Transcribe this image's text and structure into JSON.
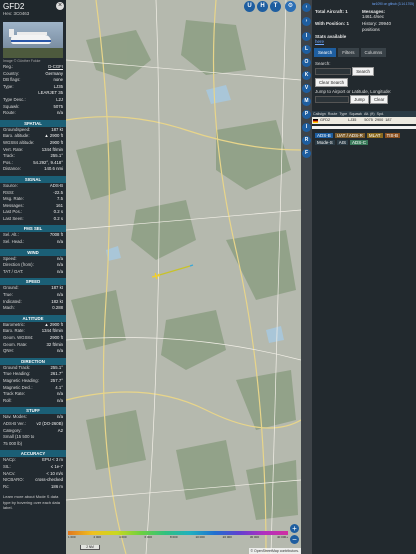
{
  "left_panel": {
    "callsign": "GFD2",
    "hex_line": "Hex: 3C0463",
    "photo_credit": "Image © Günther Fokke",
    "basic": [
      {
        "label": "Reg.:",
        "value": "D-CGFI",
        "link": true
      },
      {
        "label": "Country:",
        "value": "Germany"
      },
      {
        "label": "DB flags:",
        "value": "none"
      },
      {
        "label": "Type:",
        "value": "LJ35"
      },
      {
        "label": "",
        "value": "LEARJET 35"
      },
      {
        "label": "Type Desc.:",
        "value": "L2J"
      },
      {
        "label": "Squawk:",
        "value": "5075"
      },
      {
        "label": "Route:",
        "value": "n/a"
      }
    ],
    "sections": [
      {
        "title": "SPATIAL",
        "rows": [
          {
            "label": "Groundspeed:",
            "value": "187 kt"
          },
          {
            "label": "Baro. altitude:",
            "value": "▲ 2900 ft"
          },
          {
            "label": "WGS84 altitude:",
            "value": "2900 ft"
          },
          {
            "label": "Vert. Rate:",
            "value": "1344 ft/min"
          },
          {
            "label": "Track:",
            "value": "255.1°"
          },
          {
            "label": "Pos.:",
            "value": "54.292°, 9.418°"
          },
          {
            "label": "Distance:",
            "value": "140.6 nmi"
          }
        ]
      },
      {
        "title": "SIGNAL",
        "rows": [
          {
            "label": "Source:",
            "value": "ADS-B"
          },
          {
            "label": "RSSI:",
            "value": "-22.5"
          },
          {
            "label": "Msg. Rate:",
            "value": "7.5"
          },
          {
            "label": "Messages:",
            "value": "161"
          },
          {
            "label": "Last Pos.:",
            "value": "0.2 s"
          },
          {
            "label": "Last Seen:",
            "value": "0.2 s"
          }
        ]
      },
      {
        "title": "FMS SEL",
        "rows": [
          {
            "label": "Sel. Alt.:",
            "value": "7008 ft"
          },
          {
            "label": "Sel. Head.:",
            "value": "n/a"
          }
        ]
      },
      {
        "title": "WIND",
        "rows": [
          {
            "label": "Speed:",
            "value": "n/a"
          },
          {
            "label": "Direction (from):",
            "value": "n/a"
          },
          {
            "label": "TAT / OAT:",
            "value": "n/a"
          }
        ]
      },
      {
        "title": "SPEED",
        "rows": [
          {
            "label": "Ground:",
            "value": "187 kt"
          },
          {
            "label": "True:",
            "value": "n/a"
          },
          {
            "label": "Indicated:",
            "value": "182 kt"
          },
          {
            "label": "Mach:",
            "value": "0.288"
          }
        ]
      },
      {
        "title": "ALTITUDE",
        "rows": [
          {
            "label": "Barometric:",
            "value": "▲ 2900 ft"
          },
          {
            "label": "Baro. Rate:",
            "value": "1344 ft/min"
          },
          {
            "label": "Geom. WGS84:",
            "value": "2900 ft"
          },
          {
            "label": "Geom. Rate:",
            "value": "32 ft/min"
          },
          {
            "label": "QNH:",
            "value": "n/a"
          }
        ]
      },
      {
        "title": "DIRECTION",
        "rows": [
          {
            "label": "Ground Track:",
            "value": "255.1°"
          },
          {
            "label": "True Heading:",
            "value": "261.7°"
          },
          {
            "label": "Magnetic Heading:",
            "value": "257.7°"
          },
          {
            "label": "Magnetic Decl.:",
            "value": "4.1°"
          },
          {
            "label": "Track Rate:",
            "value": "n/a"
          },
          {
            "label": "Roll:",
            "value": "n/a"
          }
        ]
      },
      {
        "title": "STUFF",
        "rows": [
          {
            "label": "Nav. Modes:",
            "value": "n/a"
          },
          {
            "label": "ADS-B Ver.:",
            "value": "v2 (DO-260B)"
          },
          {
            "label": "Category:",
            "value": "A2"
          },
          {
            "label": "Small (15 500 to",
            "value": ""
          },
          {
            "label": "75 000 lb)",
            "value": ""
          }
        ]
      },
      {
        "title": "ACCURACY",
        "rows": [
          {
            "label": "NACp:",
            "value": "EPU < 3 m"
          },
          {
            "label": "SIL:",
            "value": "≤ 1e-7"
          },
          {
            "label": "NACv:",
            "value": "< 10 m/s"
          },
          {
            "label": "NICBARO:",
            "value": "cross-checked"
          },
          {
            "label": "Rc:",
            "value": "186 m"
          }
        ]
      }
    ],
    "footer": "Learn more about Mode S data type by hovering over each data label."
  },
  "map": {
    "top_buttons": [
      "U",
      "H",
      "T"
    ],
    "altitude_labels": [
      "1 000",
      "2 000",
      "4 000",
      "6 000",
      "8 000",
      "10 000",
      "20 000",
      "30 000",
      "40 000+"
    ],
    "scale": "2 NM",
    "attribution": "© OpenStreetMap contributors.",
    "zoom_in": "+",
    "zoom_out": "−"
  },
  "toolbar": [
    "I",
    "L",
    "O",
    "K",
    "V",
    "M",
    "P",
    "I",
    "R",
    "F"
  ],
  "right_panel": {
    "version": "tar1090 on github (3.14.1705)",
    "stats": {
      "total_label": "Total Aircraft: 1",
      "messages_label": "Messages:",
      "messages_value": "1461.4/sec",
      "with_pos_label": "With Position: 1",
      "history_label": "History: 29940",
      "history_value": "positions",
      "stats_available": "Stats available",
      "here": "here"
    },
    "tabs": [
      "Search",
      "Filters",
      "Columns"
    ],
    "search_label": "Search:",
    "search_button": "Search",
    "clear_search": "Clear Search",
    "jump_label": "Jump to Airport or Latitude, Longitude:",
    "jump_button": "Jump",
    "clear_button": "Clear",
    "columns": [
      "Callsign",
      "Route",
      "Type",
      "Squawk",
      "Alt. (ft)",
      "Spd."
    ],
    "aircraft_row": {
      "callsign": "GFD2",
      "route": "",
      "type": "LJ35",
      "squawk": "5075",
      "alt": "2900",
      "spd": "187"
    },
    "legend": [
      {
        "label": "ADS-B",
        "color": "#1e5ea0"
      },
      {
        "label": "UAT / ADS-R",
        "color": "#7a5a2a"
      },
      {
        "label": "MLAT",
        "color": "#8a6a20"
      },
      {
        "label": "TIS-B",
        "color": "#8a5020"
      },
      {
        "label": "Mode-S",
        "color": "#2a3a44"
      },
      {
        "label": "AIS",
        "color": "#2a3a44"
      },
      {
        "label": "ADS-C",
        "color": "#3a7a5a"
      }
    ]
  }
}
